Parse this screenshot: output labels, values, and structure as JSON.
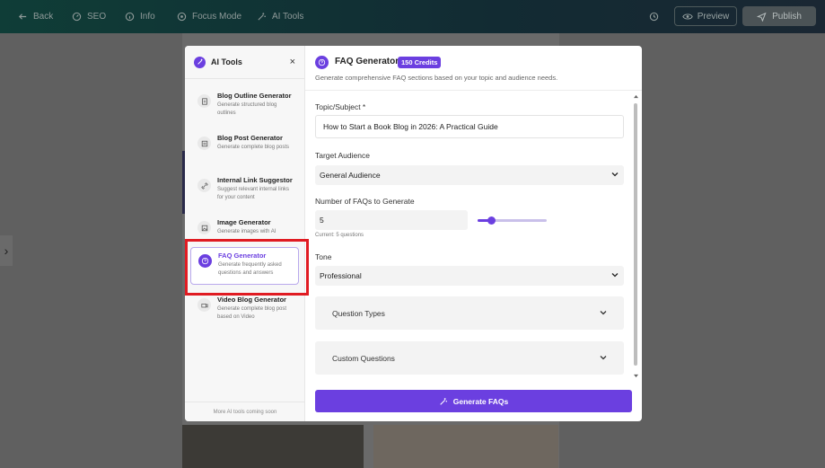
{
  "topbar": {
    "back": "Back",
    "seo": "SEO",
    "info": "Info",
    "focus_mode": "Focus Mode",
    "ai_tools": "AI Tools",
    "preview": "Preview",
    "publish": "Publish"
  },
  "sidebar": {
    "title": "AI Tools",
    "close_symbol": "×",
    "items": [
      {
        "name": "Blog Outline Generator",
        "desc": "Generate structured blog outlines",
        "icon": "document-icon"
      },
      {
        "name": "Blog Post Generator",
        "desc": "Generate complete blog posts",
        "icon": "post-icon"
      },
      {
        "name": "Internal Link Suggestor",
        "desc": "Suggest relevant internal links for your content",
        "icon": "link-icon"
      },
      {
        "name": "Image Generator",
        "desc": "Generate images with AI",
        "icon": "image-icon"
      },
      {
        "name": "FAQ Generator",
        "desc": "Generate frequently asked questions and answers",
        "icon": "question-icon"
      },
      {
        "name": "Video Blog Generator",
        "desc": "Generate complete blog post based on Video",
        "icon": "video-icon"
      }
    ],
    "footer": "More AI tools coming soon"
  },
  "main": {
    "title": "FAQ Generator",
    "badge": "150 Credits",
    "subtitle": "Generate comprehensive FAQ sections based on your topic and audience needs.",
    "topic_label": "Topic/Subject *",
    "topic_value": "How to Start a Book Blog in 2026: A Practical Guide",
    "audience_label": "Target Audience",
    "audience_value": "General Audience",
    "num_label": "Number of FAQs to Generate",
    "num_value": "5",
    "num_slider_fraction": 0.2,
    "current_text": "Current: 5 questions",
    "tone_label": "Tone",
    "tone_value": "Professional",
    "question_types": "Question Types",
    "custom_questions": "Custom Questions",
    "generate_button": "Generate FAQs"
  },
  "colors": {
    "accent": "#6b3fe0",
    "highlight": "#e01b22"
  }
}
